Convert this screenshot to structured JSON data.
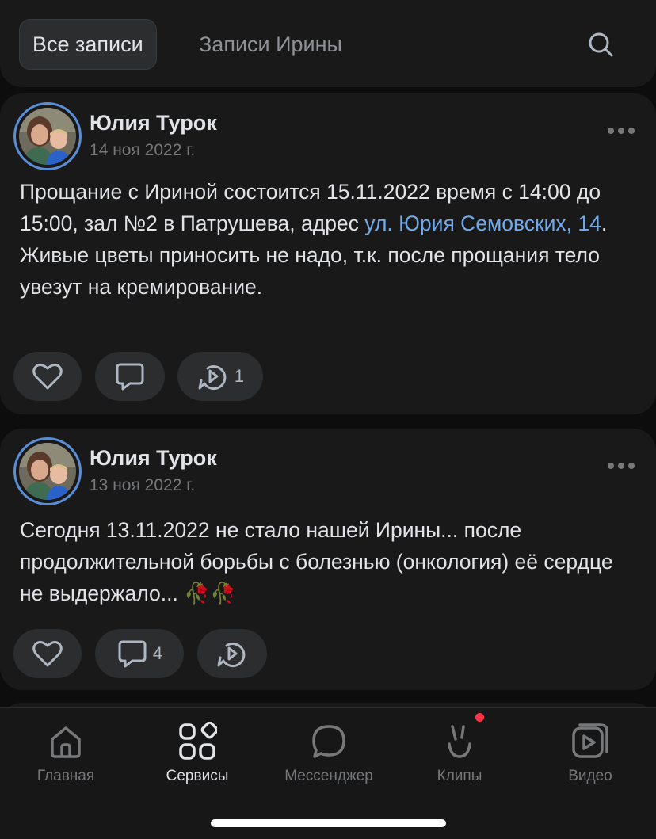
{
  "tabs": {
    "all_posts": "Все записи",
    "owner_posts": "Записи Ирины"
  },
  "posts": [
    {
      "author": "Юлия Турок",
      "date": "14 ноя 2022 г.",
      "text_before_link": "Прощание с Ириной состоится 15.11.2022 время с 14:00 до 15:00, зал №2 в Патрушева, адрес ",
      "link_text": "ул. Юрия Семовских, 14",
      "text_after_link": ".",
      "text_line2": "Живые цветы приносить не надо, т.к. после прощания тело увезут на кремирование.",
      "like_count": "",
      "comment_count": "",
      "repost_count": "1"
    },
    {
      "author": "Юлия Турок",
      "date": "13 ноя 2022 г.",
      "text": "Сегодня 13.11.2022 не стало нашей Ирины... после продолжительной борьбы с болезнью (онкология) её сердце не выдержало... 🥀🥀",
      "like_count": "",
      "comment_count": "4",
      "repost_count": ""
    }
  ],
  "tabbar": {
    "items": [
      {
        "label": "Главная",
        "icon": "home-icon"
      },
      {
        "label": "Сервисы",
        "icon": "services-icon"
      },
      {
        "label": "Мессенджер",
        "icon": "messenger-icon"
      },
      {
        "label": "Клипы",
        "icon": "clips-icon"
      },
      {
        "label": "Видео",
        "icon": "video-icon"
      }
    ],
    "active": "Сервисы"
  },
  "colors": {
    "background": "#0d0d0e",
    "card": "#19191a",
    "link": "#71aaeb",
    "avatar_ring": "#5a8ed6",
    "badge": "#ff3347"
  }
}
